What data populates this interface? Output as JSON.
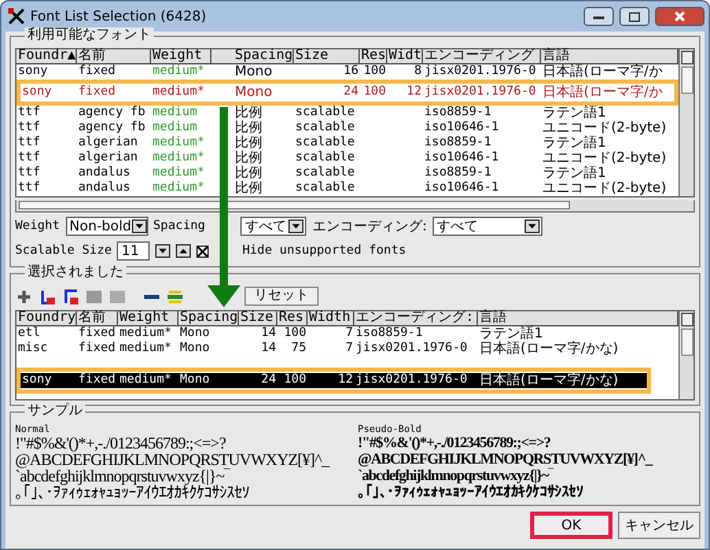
{
  "window": {
    "title": "Font List Selection (6428)"
  },
  "available": {
    "title": "利用可能なフォント",
    "columns": [
      "Foundr▲",
      "名前",
      "Weight",
      "Spacing",
      "Size",
      "Res",
      "Widt",
      "エンコーディング",
      "言語"
    ],
    "rows": [
      {
        "cells": [
          "sony",
          "fixed",
          "medium*",
          "Mono",
          "16",
          "100",
          "8",
          "jisx0201.1976-0",
          "日本語(ローマ字/か"
        ],
        "highlighted": false
      },
      {
        "cells": [
          "sony",
          "fixed",
          "medium*",
          "Mono",
          "24",
          "100",
          "12",
          "jisx0201.1976-0",
          "日本語(ローマ字/か"
        ],
        "highlighted": true
      },
      {
        "cells": [
          "ttf",
          "agency fb",
          "medium",
          "比例",
          "scalable",
          "",
          "",
          "iso8859-1",
          "ラテン語1"
        ],
        "highlighted": false
      },
      {
        "cells": [
          "ttf",
          "agency fb",
          "medium",
          "比例",
          "scalable",
          "",
          "",
          "iso10646-1",
          "ユニコード(2-byte)"
        ],
        "highlighted": false
      },
      {
        "cells": [
          "ttf",
          "algerian",
          "medium*",
          "比例",
          "scalable",
          "",
          "",
          "iso8859-1",
          "ラテン語1"
        ],
        "highlighted": false
      },
      {
        "cells": [
          "ttf",
          "algerian",
          "medium*",
          "比例",
          "scalable",
          "",
          "",
          "iso10646-1",
          "ユニコード(2-byte)"
        ],
        "highlighted": false
      },
      {
        "cells": [
          "ttf",
          "andalus",
          "medium*",
          "比例",
          "scalable",
          "",
          "",
          "iso8859-1",
          "ラテン語1"
        ],
        "highlighted": false
      },
      {
        "cells": [
          "ttf",
          "andalus",
          "medium*",
          "比例",
          "scalable",
          "",
          "",
          "iso10646-1",
          "ユニコード(2-byte)"
        ],
        "highlighted": false
      }
    ]
  },
  "filters": {
    "weight": {
      "label": "Weight",
      "value": "Non-bold"
    },
    "spacing": {
      "label": "Spacing",
      "value": "すべて"
    },
    "encoding": {
      "label": "エンコーディング:",
      "value": "すべて"
    },
    "scalable_size": {
      "label": "Scalable Size",
      "value": "11"
    },
    "hide_unsupported": {
      "label": "Hide unsupported fonts",
      "checked": true
    }
  },
  "selected": {
    "title": "選択されました",
    "reset_label": "リセット",
    "columns": [
      "Foundry",
      "名前",
      "Weight",
      "Spacing",
      "Size",
      "Res",
      "Width",
      "エンコーディング:",
      "言語"
    ],
    "rows": [
      {
        "cells": [
          "etl",
          "fixed",
          "medium*",
          "Mono",
          "14",
          "100",
          "7",
          "iso8859-1",
          "ラテン語1"
        ],
        "selected": false
      },
      {
        "cells": [
          "misc",
          "fixed",
          "medium*",
          "Mono",
          "14",
          "75",
          "7",
          "jisx0201.1976-0",
          "日本語(ローマ字/かな)"
        ],
        "selected": false
      },
      {
        "cells": [
          "sony",
          "fixed",
          "medium*",
          "Mono",
          "24",
          "100",
          "12",
          "jisx0201.1976-0",
          "日本語(ローマ字/かな)"
        ],
        "selected": true
      }
    ]
  },
  "sample": {
    "title": "サンプル",
    "panels": [
      {
        "label": "Normal",
        "bold": false,
        "lines": [
          " !\"#$%&'()*+,-./0123456789:;<=>?",
          "@ABCDEFGHIJKLMNOPQRSTUVWXYZ[¥]^_",
          "`abcdefghijklmnopqrstuvwxyz{|}~‾",
          "｡｢｣､･ｦｧｨｩｪｫｬｭｮｯｰｱｲｳｴｵｶｷｸｹｺｻｼｽｾｿ"
        ]
      },
      {
        "label": "Pseudo-Bold",
        "bold": true,
        "lines": [
          " !\"#$%&'()*+,-./0123456789:;<=>?",
          "@ABCDEFGHIJKLMNOPQRSTUVWXYZ[¥]^_",
          "`abcdefghijklmnopqrstuvwxyz{|}~‾",
          "｡｢｣､･ｦｧｨｩｪｫｬｭｮｯｰｱｲｳｴｵｶｷｸｹｺｻｼｽｾｿ"
        ]
      }
    ]
  },
  "buttons": [
    {
      "label": "OK",
      "focused": true
    },
    {
      "label": "キャンセル",
      "focused": false
    }
  ]
}
